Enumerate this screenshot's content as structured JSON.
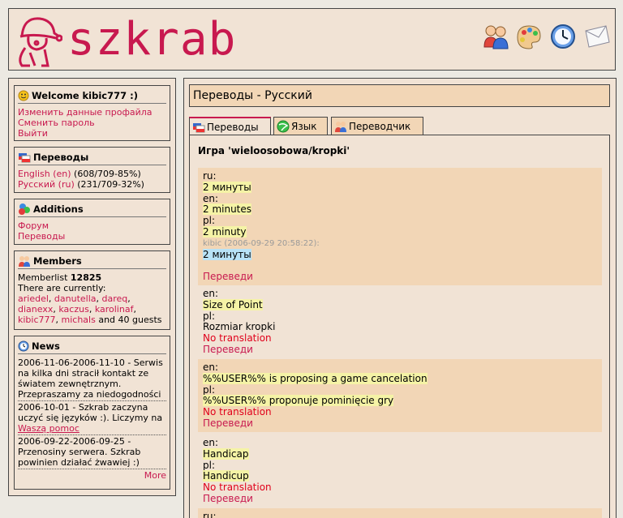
{
  "header": {
    "logo_text": "szkrab",
    "icons": [
      "users-icon",
      "palette-icon",
      "clock-icon",
      "mail-icon"
    ]
  },
  "sidebar": {
    "welcome": {
      "title": "Welcome kibic777 :)",
      "links": [
        "Изменить данные профайла",
        "Сменить пароль",
        "Выйти"
      ]
    },
    "translations": {
      "title": "Переводы",
      "items": [
        {
          "link": "English (en)",
          "stat": " (608/709-85%)"
        },
        {
          "link": "Русский (ru)",
          "stat": " (231/709-32%)"
        }
      ]
    },
    "additions": {
      "title": "Additions",
      "links": [
        "Форум",
        "Переводы"
      ]
    },
    "members": {
      "title": "Members",
      "memberlist_label": "Memberlist ",
      "memberlist_count": "12825",
      "currently": "There are currently:",
      "users": [
        "ariedel",
        "danutella",
        "dareq",
        "dianexx",
        "kaczus",
        "karolinaf",
        "kibic777",
        "michals"
      ],
      "guests": " and 40 guests"
    },
    "news": {
      "title": "News",
      "items": [
        {
          "text": "2006-11-06-2006-11-10 - Serwis na kilka dni stracił kontakt ze światem zewnętrznym. Przepraszamy za niedogodności"
        },
        {
          "text": "2006-10-01 - Szkrab zaczyna uczyć się języków :). Liczymy na ",
          "link": "Waszą pomoc"
        },
        {
          "text": "2006-09-22-2006-09-25 - Przenosiny serwera. Szkrab powinien działać żwawiej :)"
        }
      ],
      "more": "More"
    }
  },
  "main": {
    "title": "Переводы - Русский",
    "tabs": [
      "Переводы",
      "Язык",
      "Переводчик"
    ],
    "game_title": "Игра 'wieloosobowa/kropki'",
    "entry1": {
      "ru_label": "ru:",
      "ru_value": "2 минуты",
      "en_label": "en:",
      "en_value": "2 minutes",
      "pl_label": "pl:",
      "pl_value": "2 minuty",
      "meta": "kibic (2006-09-29 20:58:22):",
      "suggestion": "2 минуты",
      "action": "Переведи"
    },
    "entry2": {
      "en_label": "en:",
      "en_value": "Size of Point",
      "pl_label": "pl:",
      "pl_value": "Rozmiar kropki",
      "status": "No translation",
      "action": "Переведи"
    },
    "entry3": {
      "en_label": "en:",
      "en_value": "%%USER%% is proposing a game cancelation",
      "pl_label": "pl:",
      "pl_value": "%%USER%% proponuje pominięcie gry",
      "status": "No translation",
      "action": "Переведи"
    },
    "entry4": {
      "en_label": "en:",
      "en_value": "Handicap",
      "pl_label": "pl:",
      "pl_value": "Handicup",
      "status": "No translation",
      "action": "Переведи"
    },
    "entry5": {
      "ru_label": "ru:"
    }
  },
  "colors": {
    "panel": "#f1e3d5",
    "accent": "#c8194f",
    "alt_row": "#f2d6b6",
    "highlight": "#f5f3a6",
    "highlight_blue": "#b8e2f6",
    "no_translation": "#e0001b"
  }
}
